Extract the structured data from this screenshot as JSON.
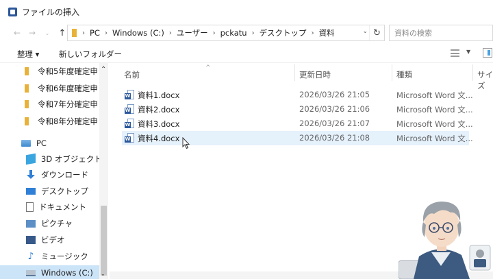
{
  "window": {
    "title": "ファイルの挿入"
  },
  "address": {
    "crumbs": [
      "PC",
      "Windows (C:)",
      "ユーザー",
      "pckatu",
      "デスクトップ",
      "資料"
    ],
    "search_placeholder": "資料の検索"
  },
  "toolbar": {
    "organize": "整理 ▾",
    "new_folder": "新しいフォルダー"
  },
  "nav": {
    "items": [
      {
        "label": "令和5年度確定申",
        "icon": "folder-icon"
      },
      {
        "label": "令和6年度確定申",
        "icon": "folder-icon"
      },
      {
        "label": "令和7年分確定申",
        "icon": "folder-icon"
      },
      {
        "label": "令和8年分確定申",
        "icon": "folder-icon"
      },
      {
        "label": "PC",
        "icon": "pc-icon"
      },
      {
        "label": "3D オブジェクト",
        "icon": "3d-objects-icon"
      },
      {
        "label": "ダウンロード",
        "icon": "download-icon"
      },
      {
        "label": "デスクトップ",
        "icon": "desktop-icon"
      },
      {
        "label": "ドキュメント",
        "icon": "document-icon"
      },
      {
        "label": "ピクチャ",
        "icon": "picture-icon"
      },
      {
        "label": "ビデオ",
        "icon": "video-icon"
      },
      {
        "label": "ミュージック",
        "icon": "music-icon"
      },
      {
        "label": "Windows (C:)",
        "icon": "drive-icon"
      }
    ]
  },
  "columns": {
    "name": "名前",
    "date": "更新日時",
    "type": "種類",
    "size": "サイズ"
  },
  "files": [
    {
      "name": "資料1.docx",
      "date": "2026/03/26 21:05",
      "type": "Microsoft Word 文..."
    },
    {
      "name": "資料2.docx",
      "date": "2026/03/26 21:06",
      "type": "Microsoft Word 文..."
    },
    {
      "name": "資料3.docx",
      "date": "2026/03/26 21:07",
      "type": "Microsoft Word 文..."
    },
    {
      "name": "資料4.docx",
      "date": "2026/03/26 21:08",
      "type": "Microsoft Word 文..."
    }
  ],
  "icons": {
    "word": "W",
    "music": "♪"
  }
}
